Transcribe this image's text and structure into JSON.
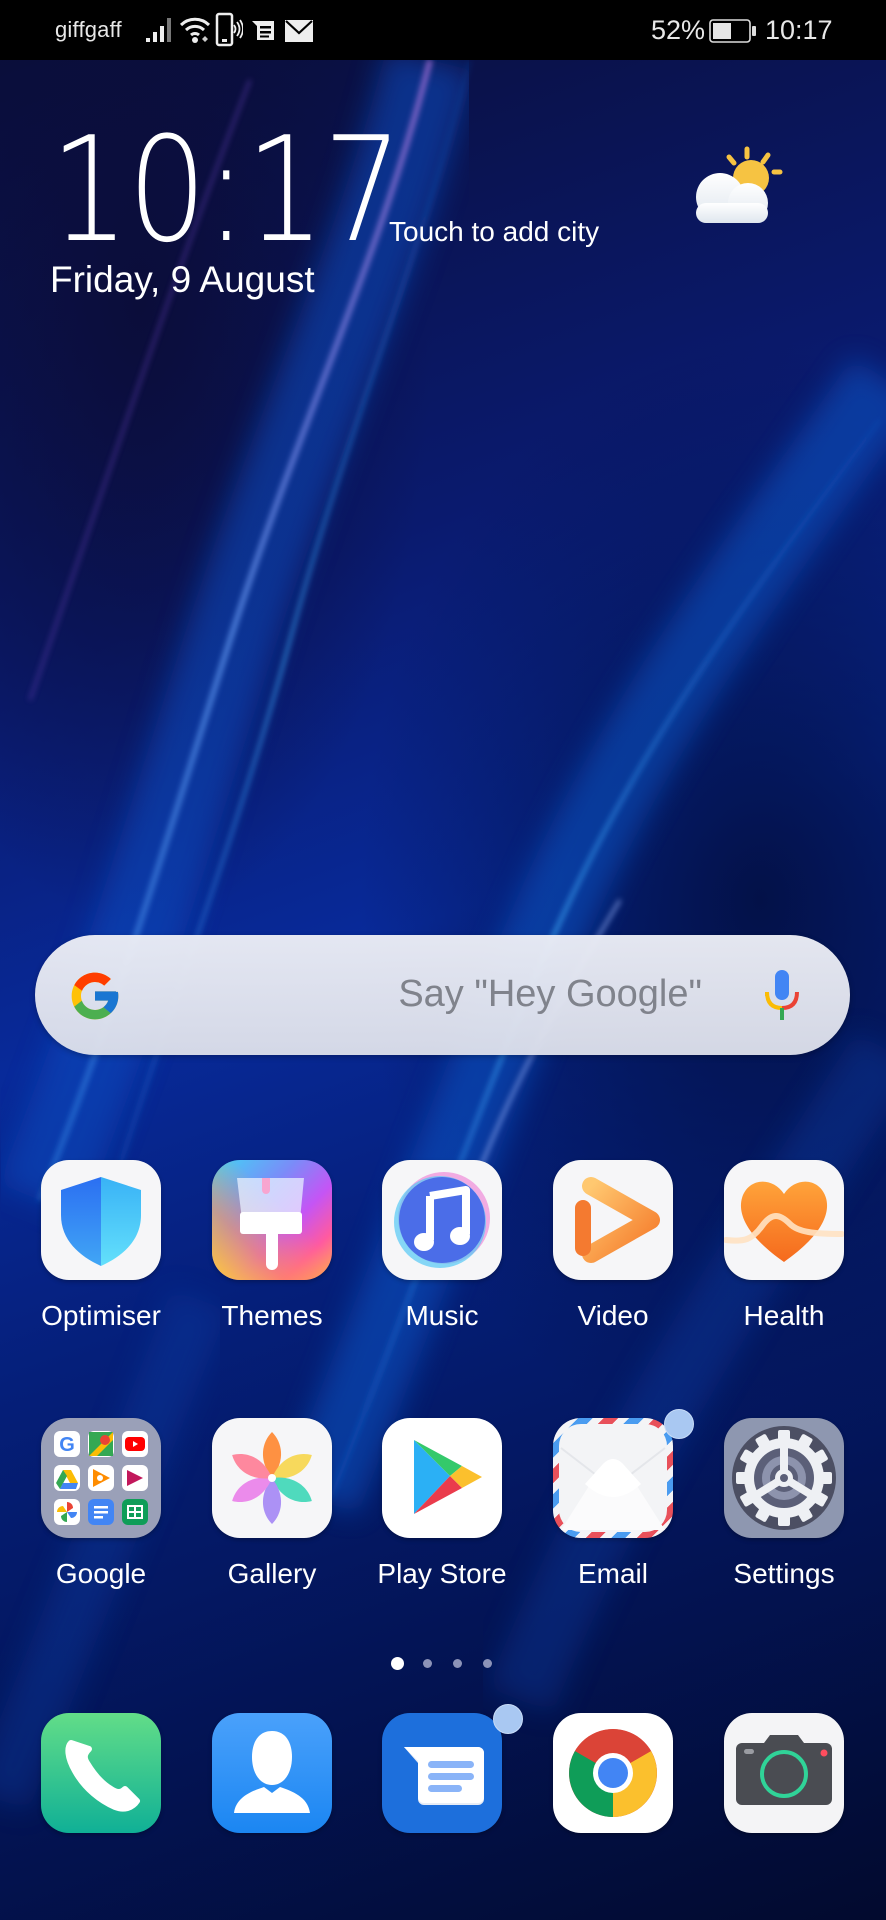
{
  "status_bar": {
    "carrier": "giffgaff",
    "left_icons": [
      "signal-icon",
      "wifi-icon",
      "nfc-phone-icon",
      "message-notification-icon",
      "mail-notification-icon"
    ],
    "battery_percent_text": "52%",
    "battery_level": 0.52,
    "time": "10:17"
  },
  "clock_widget": {
    "time": "10:17",
    "date": "Friday, 9 August",
    "city_prompt": "Touch to add city",
    "weather_icon": "partly-sunny-icon"
  },
  "search_bar": {
    "placeholder": "Say \"Hey Google\""
  },
  "apps_row1": [
    {
      "label": "Optimiser",
      "icon": "shield-icon"
    },
    {
      "label": "Themes",
      "icon": "paintbrush-icon"
    },
    {
      "label": "Music",
      "icon": "music-note-icon"
    },
    {
      "label": "Video",
      "icon": "play-icon"
    },
    {
      "label": "Health",
      "icon": "heart-icon"
    }
  ],
  "apps_row2": [
    {
      "label": "Google",
      "icon": "folder-icon"
    },
    {
      "label": "Gallery",
      "icon": "flower-icon"
    },
    {
      "label": "Play Store",
      "icon": "play-store-icon"
    },
    {
      "label": "Email",
      "icon": "envelope-icon",
      "badge": true
    },
    {
      "label": "Settings",
      "icon": "gear-icon"
    }
  ],
  "page_indicator": {
    "pages": 4,
    "current": 1
  },
  "dock": [
    {
      "name": "Phone",
      "icon": "phone-icon"
    },
    {
      "name": "Contacts",
      "icon": "contact-icon"
    },
    {
      "name": "Messages",
      "icon": "messages-icon",
      "badge": true
    },
    {
      "name": "Chrome",
      "icon": "chrome-icon"
    },
    {
      "name": "Camera",
      "icon": "camera-icon"
    }
  ],
  "colors": {
    "status_bar_bg": "#000000",
    "badge": "#a9c8f2",
    "wallpaper_primary": "#0a1a6e"
  }
}
